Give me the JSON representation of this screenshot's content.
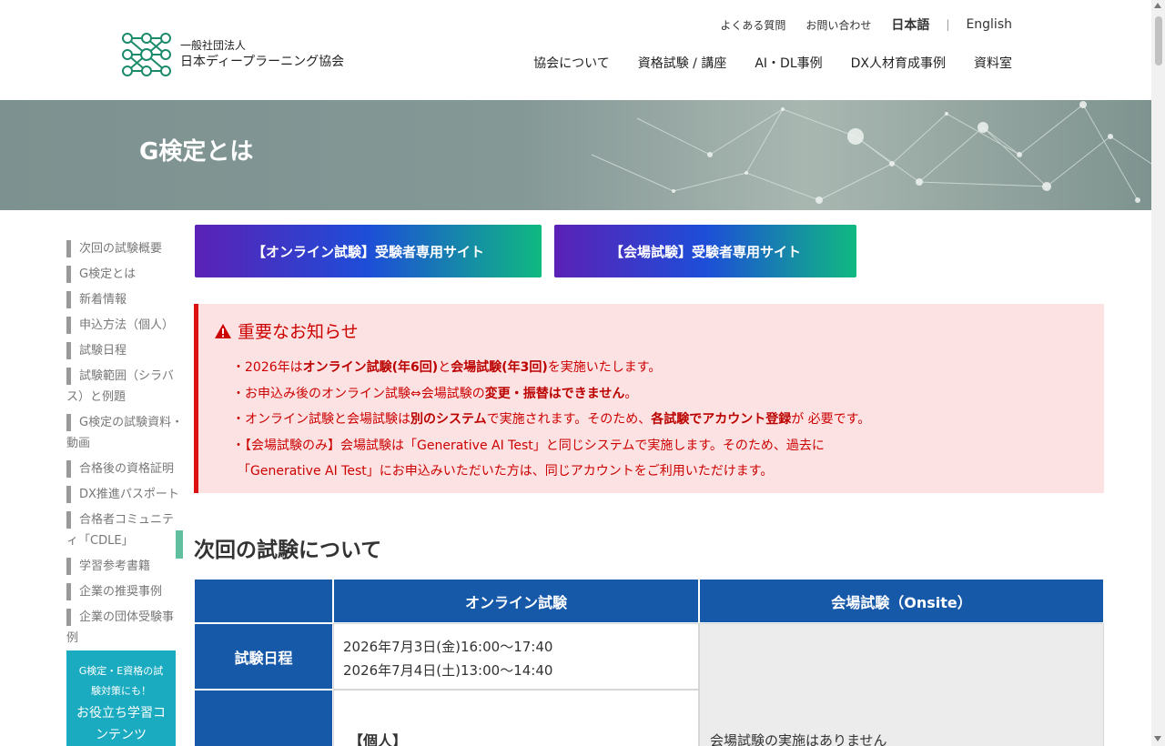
{
  "header": {
    "org_sub": "一般社団法人",
    "org_name": "日本ディープラーニング協会",
    "util_links": [
      "よくある質問",
      "お問い合わせ"
    ],
    "lang_ja": "日本語",
    "lang_sep": "|",
    "lang_en": "English",
    "nav": [
      "協会について",
      "資格試験 / 講座",
      "AI・DL事例",
      "DX人材育成事例",
      "資料室"
    ]
  },
  "hero": {
    "title": "G検定とは"
  },
  "sidebar": {
    "items": [
      {
        "label": "次回の試験概要"
      },
      {
        "label": "G検定とは"
      },
      {
        "label": "新着情報"
      },
      {
        "label": "申込方法（個人）"
      },
      {
        "label": "試験日程"
      },
      {
        "label": "試験範囲（シラバ",
        "cont": "ス）と例題"
      },
      {
        "label": "G検定の試験資料・",
        "cont": "動画"
      },
      {
        "label": "合格後の資格証明"
      },
      {
        "label": "DX推進パスポート"
      },
      {
        "label": "合格者コミュニテ",
        "cont": "ィ「CDLE」"
      },
      {
        "label": "学習参考書籍"
      },
      {
        "label": "企業の推奨事例"
      },
      {
        "label": "企業の団体受験事",
        "cont": "例"
      }
    ],
    "promo_line1": "G検定・E資格の試",
    "promo_line2": "験対策にも！",
    "promo_line3": "お役立ち学習コ",
    "promo_line4": "ンテンツ"
  },
  "cta": {
    "online": "【オンライン試験】受験者専用サイト",
    "onsite": "【会場試験】受験者専用サイト"
  },
  "notice": {
    "title": "重要なお知らせ",
    "l1_a": "・2026年は",
    "l1_b": "オンライン試験(年6回)",
    "l1_c": "と",
    "l1_d": "会場試験(年3回)",
    "l1_e": "を実施いたします。",
    "l2_a": "・お申込み後のオンライン試験⇔会場試験の",
    "l2_b": "変更・振替はできません",
    "l2_c": "。",
    "l3_a": "・オンライン試験と会場試験は",
    "l3_b": "別のシステム",
    "l3_c": "で実施されます。そのため、",
    "l3_d": "各試験でアカウント登録",
    "l3_e": "が 必要です。",
    "l4": "・【会場試験のみ】会場試験は「Generative AI Test」と同じシステムで実施します。そのため、過去に",
    "l5": "「Generative AI Test」にお申込みいただいた方は、同じアカウントをご利用いただけます。"
  },
  "section": {
    "title": "次回の試験について"
  },
  "table": {
    "col_online": "オンライン試験",
    "col_onsite": "会場試験（Onsite）",
    "row1_head": "試験日程",
    "row1_online_1": "2026年7月3日(金)16:00〜17:40",
    "row1_online_2": "2026年7月4日(土)13:00〜14:40",
    "row2_online": "【個人】",
    "onsite_note": "会場試験の実施はありません"
  },
  "colors": {
    "table_header": "#1759a9",
    "notice_bg": "#fde2e3",
    "notice_text": "#cc0000",
    "promo": "#1aabc0",
    "active": "#5fbf9f"
  }
}
